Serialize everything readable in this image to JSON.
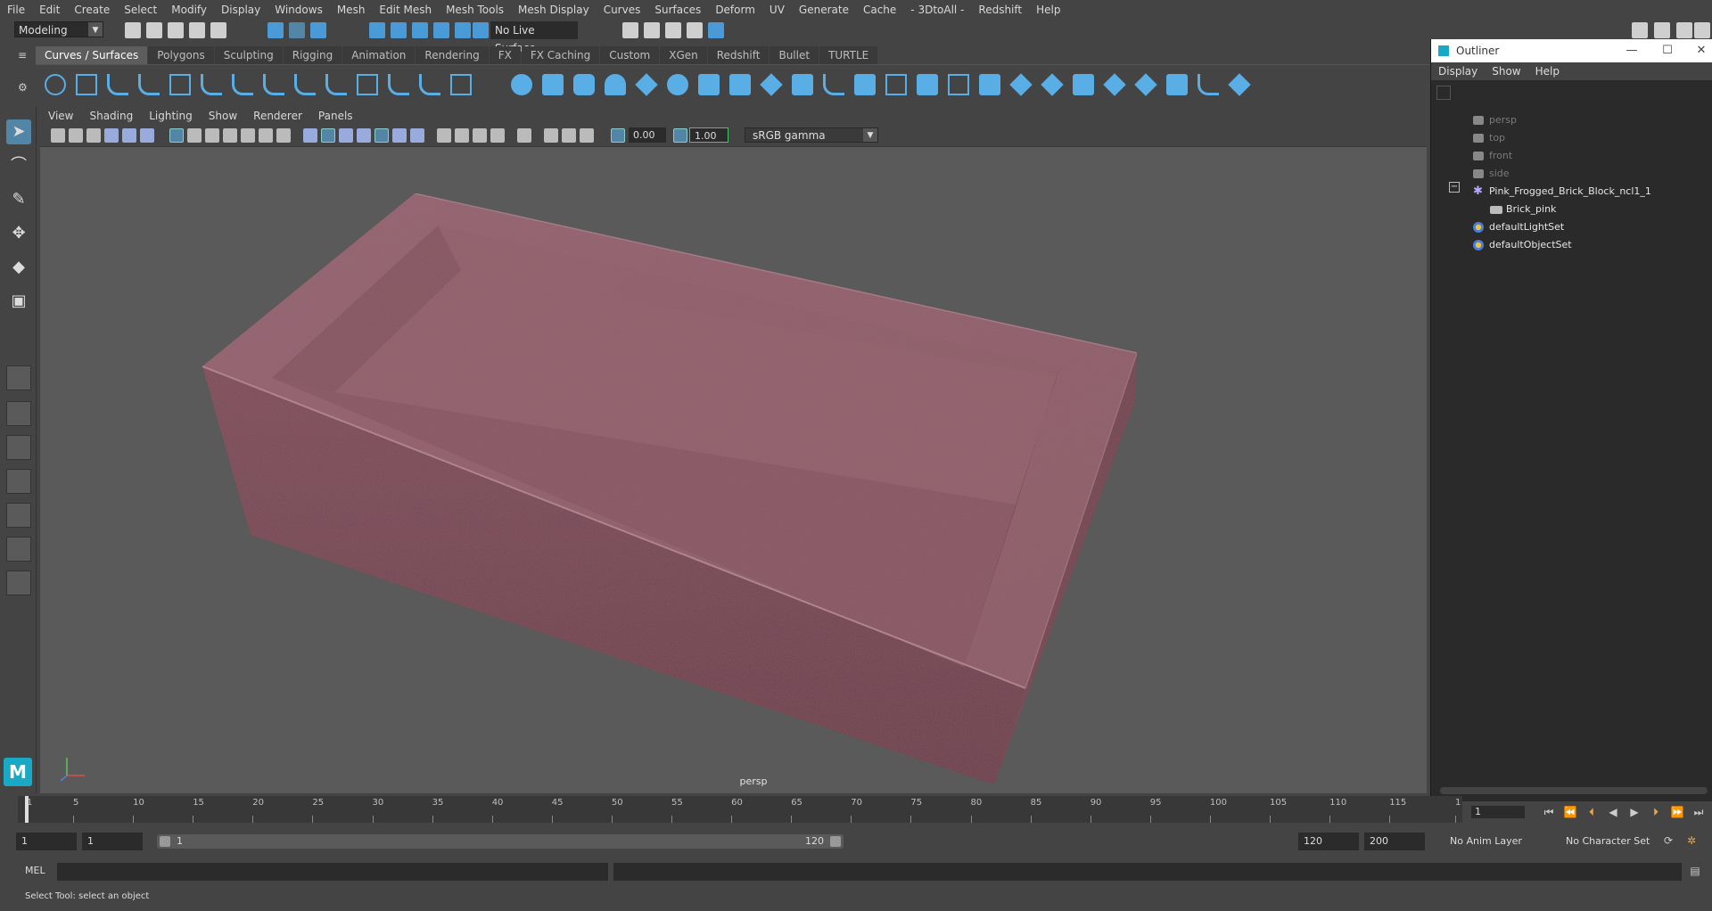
{
  "menubar": [
    "File",
    "Edit",
    "Create",
    "Select",
    "Modify",
    "Display",
    "Windows",
    "Mesh",
    "Edit Mesh",
    "Mesh Tools",
    "Mesh Display",
    "Curves",
    "Surfaces",
    "Deform",
    "UV",
    "Generate",
    "Cache",
    "- 3DtoAll -",
    "Redshift",
    "Help"
  ],
  "statusline": {
    "mode": "Modeling",
    "live_surface": "No Live Surface"
  },
  "shelf": {
    "tabs": [
      "Curves / Surfaces",
      "Polygons",
      "Sculpting",
      "Rigging",
      "Animation",
      "Rendering",
      "FX",
      "FX Caching",
      "Custom",
      "XGen",
      "Redshift",
      "Bullet",
      "TURTLE"
    ],
    "active_tab": "Curves / Surfaces"
  },
  "viewport": {
    "menu": [
      "View",
      "Shading",
      "Lighting",
      "Show",
      "Renderer",
      "Panels"
    ],
    "exposure": "0.00",
    "gamma": "1.00",
    "color_space": "sRGB gamma",
    "camera": "persp"
  },
  "outliner": {
    "title": "Outliner",
    "menu": [
      "Display",
      "Show",
      "Help"
    ],
    "items": [
      {
        "label": "persp",
        "dim": true,
        "icon": "camera-icon"
      },
      {
        "label": "top",
        "dim": true,
        "icon": "camera-icon"
      },
      {
        "label": "front",
        "dim": true,
        "icon": "camera-icon"
      },
      {
        "label": "side",
        "dim": true,
        "icon": "camera-icon"
      },
      {
        "label": "Pink_Frogged_Brick_Block_ncl1_1",
        "dim": false,
        "icon": "group-icon"
      },
      {
        "label": "Brick_pink",
        "dim": false,
        "icon": "mesh-icon"
      },
      {
        "label": "defaultLightSet",
        "dim": false,
        "icon": "set-icon"
      },
      {
        "label": "defaultObjectSet",
        "dim": false,
        "icon": "set-icon"
      }
    ]
  },
  "timeslider": {
    "ticks": [
      "1",
      "5",
      "10",
      "15",
      "20",
      "25",
      "30",
      "35",
      "40",
      "45",
      "50",
      "55",
      "60",
      "65",
      "70",
      "75",
      "80",
      "85",
      "90",
      "95",
      "100",
      "105",
      "110",
      "115",
      "1"
    ],
    "current_frame": "1"
  },
  "range": {
    "start": "1",
    "playback_start": "1",
    "slider_start": "1",
    "slider_end": "120",
    "playback_end": "120",
    "end": "200",
    "anim_layer": "No Anim Layer",
    "character_set": "No Character Set"
  },
  "command": {
    "language": "MEL"
  },
  "help": "Select Tool: select an object",
  "colors": {
    "accent": "#5285a6",
    "shelf_icon": "#5aaee6",
    "brick": "#8a5560"
  }
}
